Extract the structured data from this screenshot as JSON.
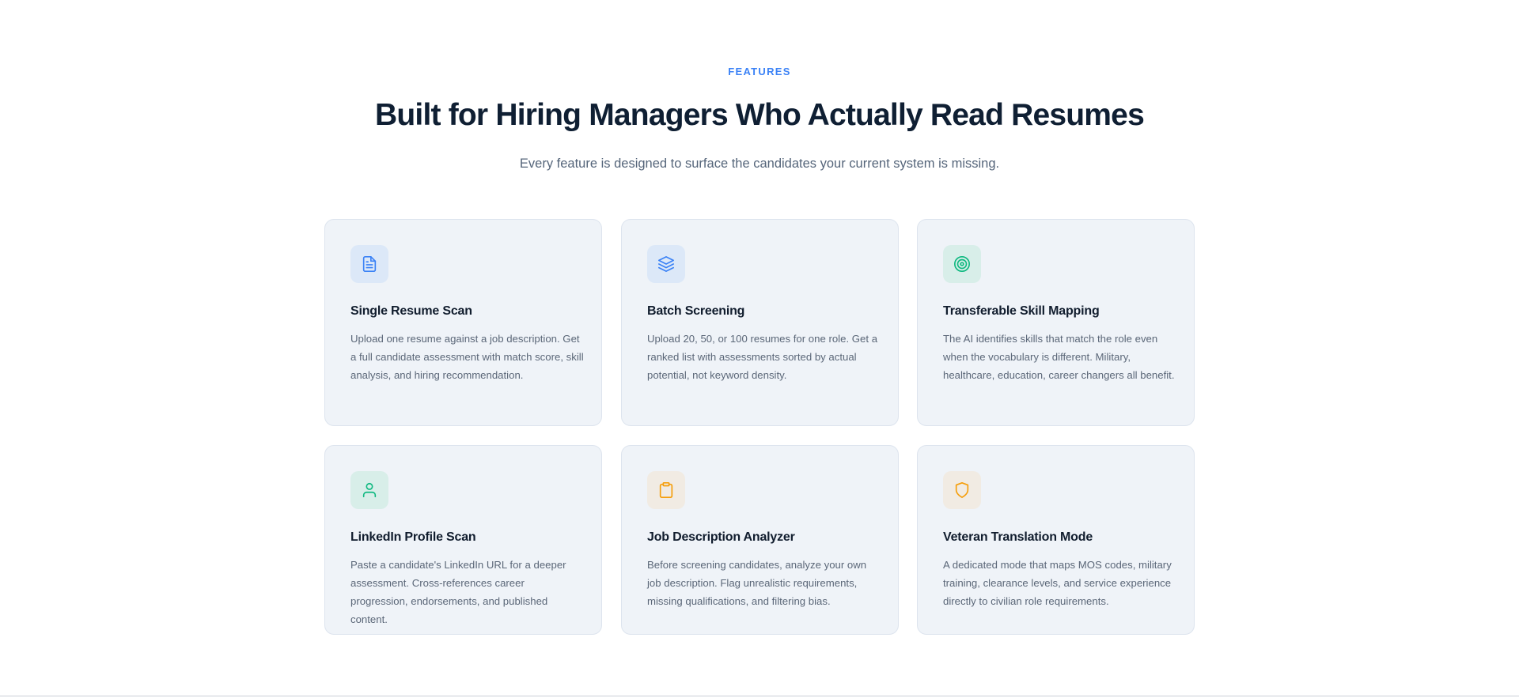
{
  "section": {
    "eyebrow": "FEATURES",
    "title": "Built for Hiring Managers Who Actually Read Resumes",
    "subtitle": "Every feature is designed to surface the candidates your current system is missing."
  },
  "features": [
    {
      "title": "Single Resume Scan",
      "description": "Upload one resume against a job description. Get a full candidate assessment with match score, skill analysis, and hiring recommendation.",
      "icon": "document-icon",
      "icon_color": "#3b82f6",
      "icon_bg": "#dce8f8"
    },
    {
      "title": "Batch Screening",
      "description": "Upload 20, 50, or 100 resumes for one role. Get a ranked list with assessments sorted by actual potential, not keyword density.",
      "icon": "layers-icon",
      "icon_color": "#3b82f6",
      "icon_bg": "#dce8f8"
    },
    {
      "title": "Transferable Skill Mapping",
      "description": "The AI identifies skills that match the role even when the vocabulary is different. Military, healthcare, education, career changers all benefit.",
      "icon": "target-icon",
      "icon_color": "#10b981",
      "icon_bg": "#d8eee9"
    },
    {
      "title": "LinkedIn Profile Scan",
      "description": "Paste a candidate's LinkedIn URL for a deeper assessment. Cross-references career progression, endorsements, and published content.",
      "icon": "user-icon",
      "icon_color": "#10b981",
      "icon_bg": "#d8eee9"
    },
    {
      "title": "Job Description Analyzer",
      "description": "Before screening candidates, analyze your own job description. Flag unrealistic requirements, missing qualifications, and filtering bias.",
      "icon": "clipboard-icon",
      "icon_color": "#f59e0b",
      "icon_bg": "#f1ebe3"
    },
    {
      "title": "Veteran Translation Mode",
      "description": "A dedicated mode that maps MOS codes, military training, clearance levels, and service experience directly to civilian role requirements.",
      "icon": "shield-icon",
      "icon_color": "#f59e0b",
      "icon_bg": "#f1ebe3"
    }
  ]
}
